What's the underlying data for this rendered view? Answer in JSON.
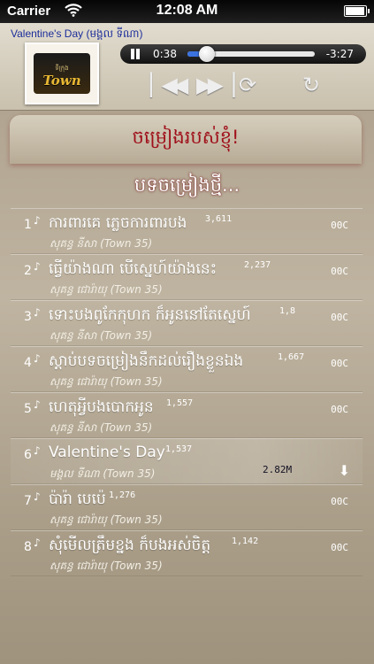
{
  "status": {
    "carrier": "Carrier",
    "time": "12:08 AM"
  },
  "player": {
    "now_playing": "Valentine's Day (មង្គល ទីណា)",
    "album_logo": "Town",
    "album_sub": "ទីក្រុង",
    "elapsed": "0:38",
    "remaining": "-3:27",
    "progress_fraction": 0.155
  },
  "tab": {
    "label": "ចម្រៀងរបស់ខ្ញុំ!"
  },
  "section": {
    "title": "បទចម្រៀងថ្មី..."
  },
  "songs": [
    {
      "num": "1",
      "title": "ការពារគេ ភ្លេចការពារបង",
      "plays": "3,611",
      "artist": "សុគន្ធ នីសា (Town 35)",
      "size": "00C"
    },
    {
      "num": "2",
      "title": "ធ្វើយ៉ាងណា បើស្នេហ៍យ៉ាងនេះ",
      "plays": "2,237",
      "artist": "សុគន្ធ ជោរ៉ាយុ (Town 35)",
      "size": "00C"
    },
    {
      "num": "3",
      "title": "ទោះបងពូកែកុហក ក៏អូននៅតែស្នេហ៍",
      "plays": "1,8",
      "artist": "សុគន្ធ នីសា (Town 35)",
      "size": "00C"
    },
    {
      "num": "4",
      "title": "ស្តាប់បទចម្រៀងនឹកដល់រឿងខ្លួនឯង",
      "plays": "1,667",
      "artist": "សុគន្ធ ជោរ៉ាយុ (Town 35)",
      "size": "00C"
    },
    {
      "num": "5",
      "title": "ហេតុអ្វីបងបោកអូន",
      "plays": "1,557",
      "artist": "សុគន្ធ នីសា (Town 35)",
      "size": "00C"
    },
    {
      "num": "6",
      "title": "Valentine's Day",
      "plays": "1,537",
      "artist": "មង្គល ទីណា (Town 35)",
      "filesize": "2.82M"
    },
    {
      "num": "7",
      "title": "ប៉ារ៉ា បេប៉េ",
      "plays": "1,276",
      "artist": "សុគន្ធ ជោរ៉ាយុ (Town 35)",
      "size": "00C"
    },
    {
      "num": "8",
      "title": "សុំមើលត្រឹមខ្នង ក៏បងអស់ចិត្ត",
      "plays": "1,142",
      "artist": "សុគន្ធ ជោរ៉ាយុ (Town 35)",
      "size": "00C"
    }
  ]
}
